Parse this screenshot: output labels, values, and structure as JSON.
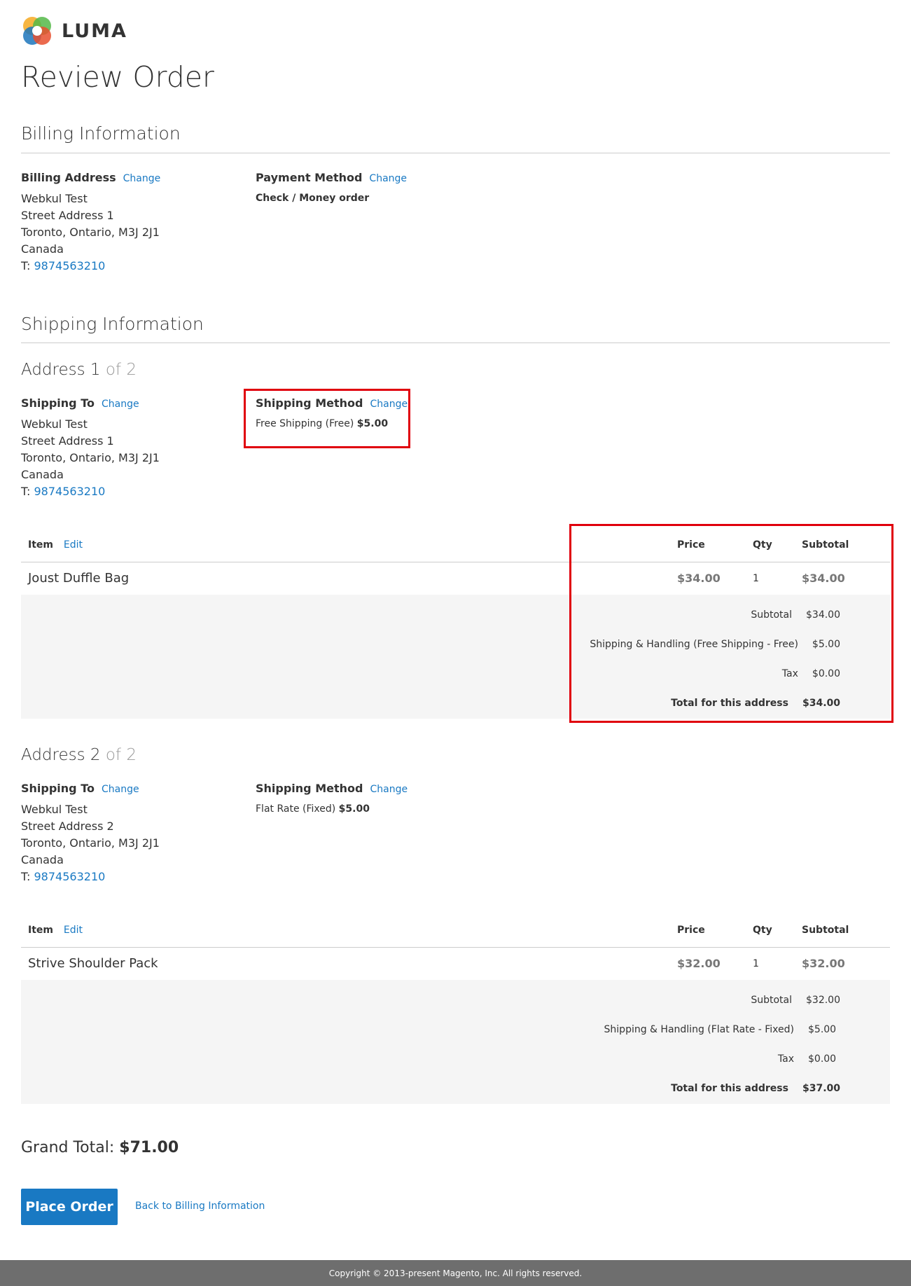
{
  "brand": {
    "name": "LUMA"
  },
  "page": {
    "title": "Review Order"
  },
  "billing": {
    "section_title": "Billing Information",
    "address_label": "Billing Address",
    "change": "Change",
    "lines": [
      "Webkul Test",
      "Street Address 1",
      "Toronto, Ontario, M3J 2J1",
      "Canada"
    ],
    "phone_prefix": "T:",
    "phone": "9874563210",
    "payment_label": "Payment Method",
    "payment_value": "Check / Money order"
  },
  "shipping": {
    "section_title": "Shipping Information",
    "addresses": [
      {
        "title": "Address 1",
        "of": "of 2",
        "ship_to_label": "Shipping To",
        "change": "Change",
        "lines": [
          "Webkul Test",
          "Street Address 1",
          "Toronto, Ontario, M3J 2J1",
          "Canada"
        ],
        "phone_prefix": "T:",
        "phone": "9874563210",
        "method_label": "Shipping Method",
        "method_text": "Free Shipping (Free)",
        "method_price": "$5.00",
        "table": {
          "col_item": "Item",
          "edit": "Edit",
          "col_price": "Price",
          "col_qty": "Qty",
          "col_subtotal": "Subtotal",
          "item_name": "Joust Duffle Bag",
          "item_price": "$34.00",
          "item_qty": "1",
          "item_subtotal": "$34.00"
        },
        "totals": {
          "subtotal_label": "Subtotal",
          "subtotal": "$34.00",
          "shipping_label": "Shipping & Handling (Free Shipping - Free)",
          "shipping": "$5.00",
          "tax_label": "Tax",
          "tax": "$0.00",
          "total_label": "Total for this address",
          "total": "$34.00"
        }
      },
      {
        "title": "Address 2",
        "of": "of 2",
        "ship_to_label": "Shipping To",
        "change": "Change",
        "lines": [
          "Webkul Test",
          "Street Address 2",
          "Toronto, Ontario, M3J 2J1",
          "Canada"
        ],
        "phone_prefix": "T:",
        "phone": "9874563210",
        "method_label": "Shipping Method",
        "method_text": "Flat Rate (Fixed)",
        "method_price": "$5.00",
        "table": {
          "col_item": "Item",
          "edit": "Edit",
          "col_price": "Price",
          "col_qty": "Qty",
          "col_subtotal": "Subtotal",
          "item_name": "Strive Shoulder Pack",
          "item_price": "$32.00",
          "item_qty": "1",
          "item_subtotal": "$32.00"
        },
        "totals": {
          "subtotal_label": "Subtotal",
          "subtotal": "$32.00",
          "shipping_label": "Shipping & Handling (Flat Rate - Fixed)",
          "shipping": "$5.00",
          "tax_label": "Tax",
          "tax": "$0.00",
          "total_label": "Total for this address",
          "total": "$37.00"
        }
      }
    ]
  },
  "grand_total": {
    "label": "Grand Total:",
    "value": "$71.00"
  },
  "actions": {
    "place_order": "Place Order",
    "back": "Back to Billing Information"
  },
  "footer": {
    "copyright": "Copyright © 2013-present Magento, Inc. All rights reserved."
  },
  "colors": {
    "link": "#1979c3",
    "button": "#1979c3",
    "highlight": "#e0000c",
    "footer_bg": "#6e6e6e"
  }
}
